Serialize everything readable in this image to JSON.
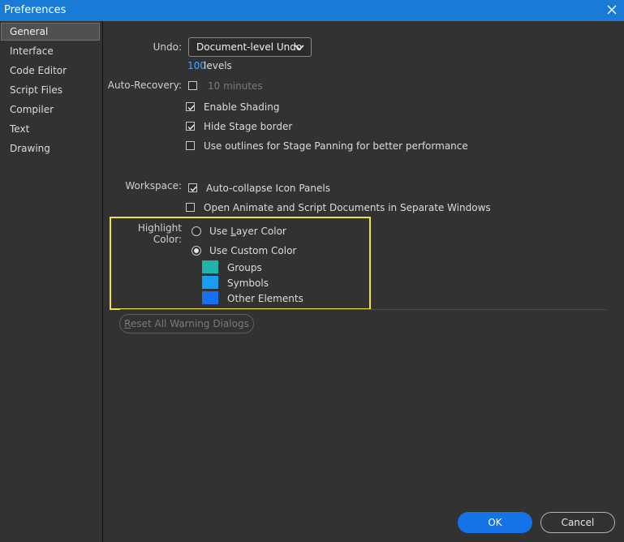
{
  "window": {
    "title": "Preferences"
  },
  "sidebar": {
    "items": [
      {
        "label": "General",
        "selected": true
      },
      {
        "label": "Interface"
      },
      {
        "label": "Code Editor"
      },
      {
        "label": "Script Files"
      },
      {
        "label": "Compiler"
      },
      {
        "label": "Text"
      },
      {
        "label": "Drawing"
      }
    ]
  },
  "general": {
    "undo": {
      "label": "Undo:",
      "selected": "Document-level Undo",
      "levels_value": "100",
      "levels_label": "levels"
    },
    "auto_recovery": {
      "label": "Auto-Recovery:",
      "checked": false,
      "minutes_text": "10 minutes"
    },
    "options": [
      {
        "label": "Enable Shading",
        "checked": true
      },
      {
        "label": "Hide Stage border",
        "checked": true
      },
      {
        "label": "Use outlines for Stage Panning for better performance",
        "checked": false
      }
    ],
    "workspace": {
      "label": "Workspace:",
      "auto_collapse": {
        "label": "Auto-collapse Icon Panels",
        "checked": true
      },
      "separate_windows": {
        "label": "Open Animate and Script Documents in Separate Windows",
        "checked": false
      }
    },
    "highlight": {
      "label": "Highlight Color:",
      "use_layer_color": {
        "label_pre": "Use ",
        "label_u": "L",
        "label_post": "ayer Color",
        "selected": false
      },
      "use_custom_color": {
        "label": "Use Custom Color",
        "selected": true
      },
      "swatches": [
        {
          "label": "Groups",
          "color": "#1fb5ad"
        },
        {
          "label": "Symbols",
          "color": "#1a9cf0"
        },
        {
          "label": "Other Elements",
          "color": "#1670f0"
        }
      ]
    },
    "reset_button": {
      "label_u": "R",
      "label_post": "eset All Warning Dialogs"
    }
  },
  "footer": {
    "ok": "OK",
    "cancel": "Cancel"
  },
  "colors": {
    "titlebar": "#1a7bd6",
    "accent": "#1473e6",
    "highlight_outline": "#f2e23a"
  }
}
